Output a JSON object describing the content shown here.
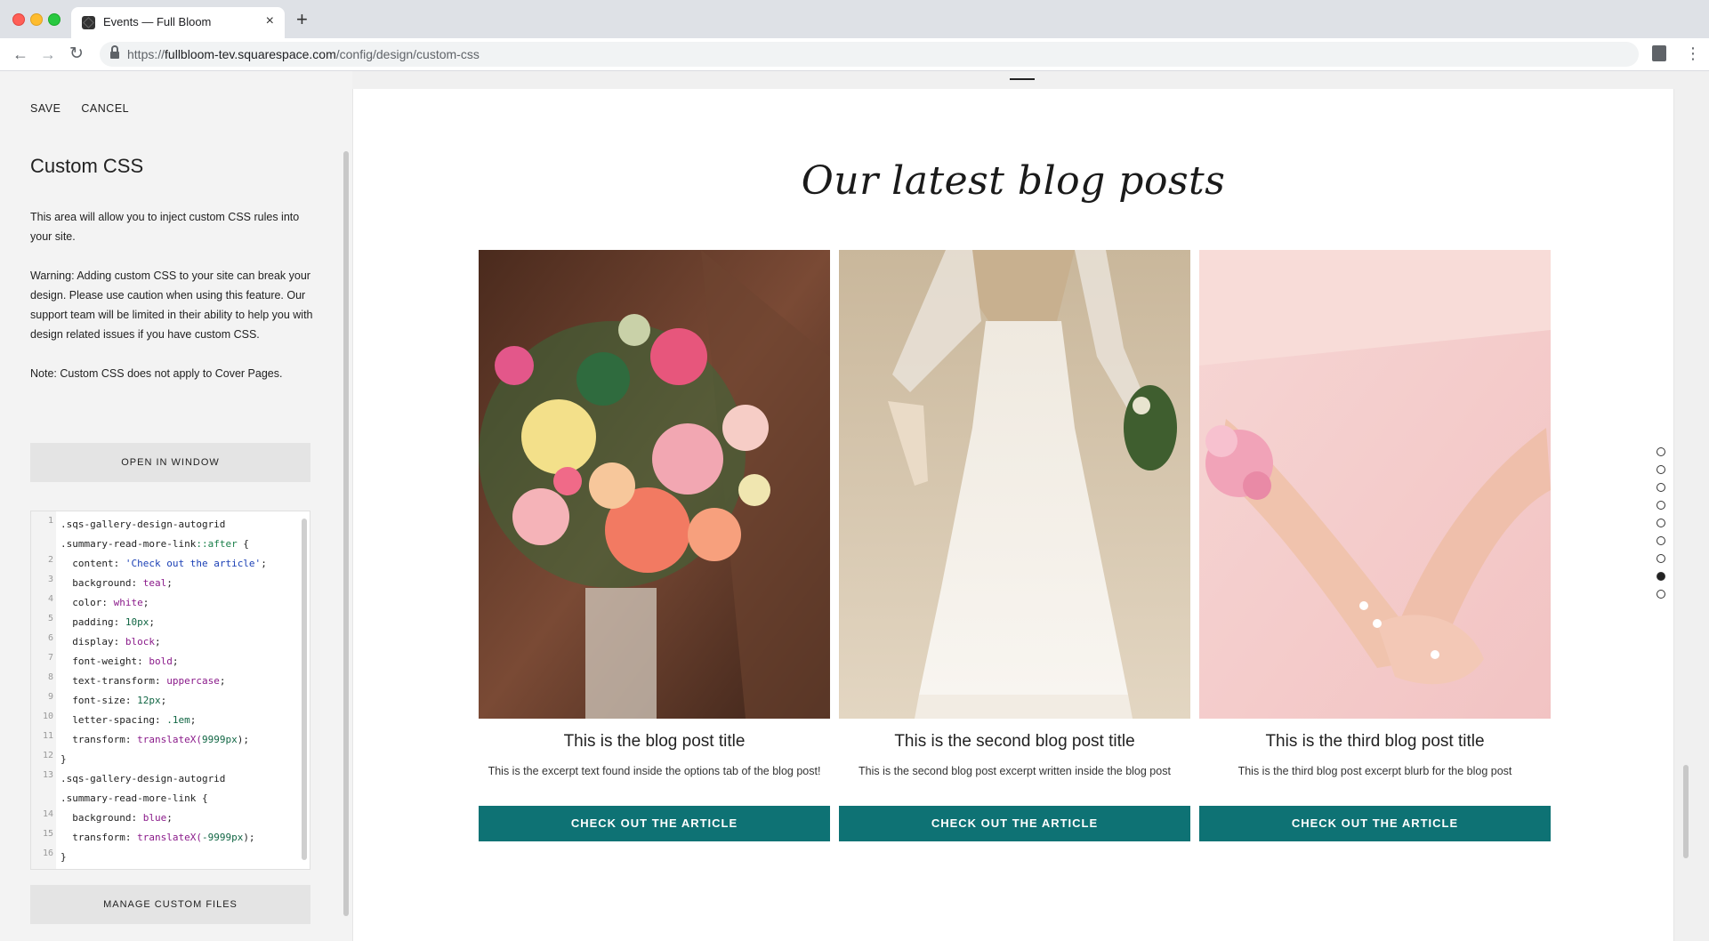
{
  "browser": {
    "tab_title": "Events — Full Bloom",
    "tab_close": "×",
    "new_tab": "+",
    "url_scheme": "https://",
    "url_host": "fullbloom-tev.squarespace.com",
    "url_path": "/config/design/custom-css",
    "icons": {
      "back": "←",
      "forward": "→",
      "reload": "↻",
      "menu": "⋮"
    }
  },
  "panel": {
    "save_label": "SAVE",
    "cancel_label": "CANCEL",
    "title": "Custom CSS",
    "intro": "This area will allow you to inject custom CSS rules into your site.",
    "warning": "Warning: Adding custom CSS to your site can break your design. Please use caution when using this feature. Our support team will be limited in their ability to help you with design related issues if you have custom CSS.",
    "note": "Note: Custom CSS does not apply to Cover Pages.",
    "open_window_label": "OPEN IN WINDOW",
    "manage_files_label": "MANAGE CUSTOM FILES"
  },
  "code": {
    "lines": [
      {
        "n": "1",
        "parts": [
          {
            "t": ".sqs-gallery-design-autogrid",
            "c": "sel"
          }
        ]
      },
      {
        "n": "",
        "parts": [
          {
            "t": ".summary-read-more-link",
            "c": "sel"
          },
          {
            "t": "::after",
            "c": "pseudo"
          },
          {
            "t": " {",
            "c": "sel"
          }
        ]
      },
      {
        "n": "2",
        "parts": [
          {
            "t": "  content: ",
            "c": "prop"
          },
          {
            "t": "'Check out the article'",
            "c": "str"
          },
          {
            "t": ";",
            "c": "prop"
          }
        ]
      },
      {
        "n": "3",
        "parts": [
          {
            "t": "  background: ",
            "c": "prop"
          },
          {
            "t": "teal",
            "c": "kw"
          },
          {
            "t": ";",
            "c": "prop"
          }
        ]
      },
      {
        "n": "4",
        "parts": [
          {
            "t": "  color: ",
            "c": "prop"
          },
          {
            "t": "white",
            "c": "kw"
          },
          {
            "t": ";",
            "c": "prop"
          }
        ]
      },
      {
        "n": "5",
        "parts": [
          {
            "t": "  padding: ",
            "c": "prop"
          },
          {
            "t": "10px",
            "c": "num"
          },
          {
            "t": ";",
            "c": "prop"
          }
        ]
      },
      {
        "n": "6",
        "parts": [
          {
            "t": "  display: ",
            "c": "prop"
          },
          {
            "t": "block",
            "c": "kw"
          },
          {
            "t": ";",
            "c": "prop"
          }
        ]
      },
      {
        "n": "7",
        "parts": [
          {
            "t": "  font-weight: ",
            "c": "prop"
          },
          {
            "t": "bold",
            "c": "kw"
          },
          {
            "t": ";",
            "c": "prop"
          }
        ]
      },
      {
        "n": "8",
        "parts": [
          {
            "t": "  text-transform: ",
            "c": "prop"
          },
          {
            "t": "uppercase",
            "c": "kw"
          },
          {
            "t": ";",
            "c": "prop"
          }
        ]
      },
      {
        "n": "9",
        "parts": [
          {
            "t": "  font-size: ",
            "c": "prop"
          },
          {
            "t": "12px",
            "c": "num"
          },
          {
            "t": ";",
            "c": "prop"
          }
        ]
      },
      {
        "n": "10",
        "parts": [
          {
            "t": "  letter-spacing: ",
            "c": "prop"
          },
          {
            "t": ".1em",
            "c": "num"
          },
          {
            "t": ";",
            "c": "prop"
          }
        ]
      },
      {
        "n": "11",
        "parts": [
          {
            "t": "  transform: ",
            "c": "prop"
          },
          {
            "t": "translateX(",
            "c": "kw"
          },
          {
            "t": "9999px",
            "c": "num"
          },
          {
            "t": ");",
            "c": "prop"
          }
        ]
      },
      {
        "n": "12",
        "parts": [
          {
            "t": "}",
            "c": "sel"
          }
        ]
      },
      {
        "n": "13",
        "parts": [
          {
            "t": ".sqs-gallery-design-autogrid",
            "c": "sel"
          }
        ]
      },
      {
        "n": "",
        "parts": [
          {
            "t": ".summary-read-more-link {",
            "c": "sel"
          }
        ]
      },
      {
        "n": "14",
        "parts": [
          {
            "t": "  background: ",
            "c": "prop"
          },
          {
            "t": "blue",
            "c": "kw"
          },
          {
            "t": ";",
            "c": "prop"
          }
        ]
      },
      {
        "n": "15",
        "parts": [
          {
            "t": "  transform: ",
            "c": "prop"
          },
          {
            "t": "translateX(",
            "c": "kw"
          },
          {
            "t": "-9999px",
            "c": "num"
          },
          {
            "t": ");",
            "c": "prop"
          }
        ]
      },
      {
        "n": "16",
        "parts": [
          {
            "t": "}",
            "c": "sel"
          }
        ]
      }
    ]
  },
  "preview": {
    "heading": "Our latest blog posts",
    "posts": [
      {
        "title": "This is the blog post title",
        "excerpt": "This is the excerpt text found inside the options tab of the blog post!",
        "button": "CHECK OUT THE ARTICLE",
        "image_desc": "bridal-bouquet"
      },
      {
        "title": "This is the second blog post title",
        "excerpt": "This is the second blog post excerpt written inside the blog post",
        "button": "CHECK OUT THE ARTICLE",
        "image_desc": "bride-on-beach"
      },
      {
        "title": "This is the third blog post title",
        "excerpt": "This is the third blog post excerpt blurb for the blog post",
        "button": "CHECK OUT THE ARTICLE",
        "image_desc": "pink-dress-corsage"
      }
    ],
    "section_dots": {
      "count": 9,
      "active_index": 7
    }
  },
  "colors": {
    "accent_teal": "#0e7274",
    "panel_bg": "#f3f3f3"
  }
}
